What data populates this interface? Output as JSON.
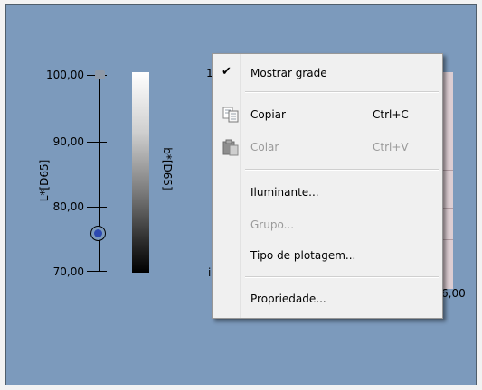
{
  "chart": {
    "l_axis_title": "L*[D65]",
    "b_axis_title": "b*[D65]",
    "ticks": [
      "100,00",
      "90,00",
      "80,00",
      "70,00"
    ],
    "right_tick_label": "6,00",
    "top_partial_label": "1",
    "left_partial_label": "i",
    "panel_color": "#7c9abc"
  },
  "context_menu": {
    "show_grid": "Mostrar grade",
    "copy": "Copiar",
    "copy_shortcut": "Ctrl+C",
    "paste": "Colar",
    "paste_shortcut": "Ctrl+V",
    "illuminant": "Iluminante...",
    "group": "Grupo...",
    "plot_type": "Tipo de plotagem...",
    "properties": "Propriedade..."
  }
}
